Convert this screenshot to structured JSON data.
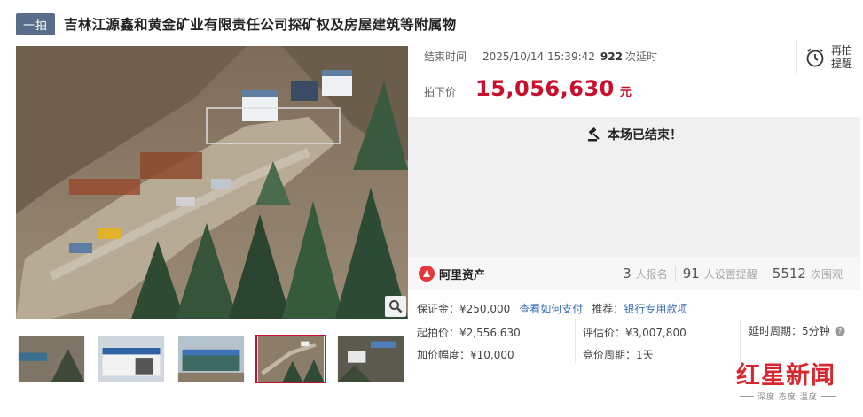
{
  "header": {
    "badge": "一拍",
    "title": "吉林江源鑫和黄金矿业有限责任公司探矿权及房屋建筑等附属物"
  },
  "auction": {
    "end_label": "结束时间",
    "end_time": "2025/10/14 15:39:42",
    "delay_count": "922",
    "delay_suffix": "次延时",
    "price_label": "拍下价",
    "price": "15,056,630",
    "price_unit": "元",
    "remind_label": "再拍提醒",
    "ended_text": "本场已结束！"
  },
  "stats": {
    "platform": "阿里资产",
    "signup_count": "3",
    "signup_label": "人报名",
    "reminder_count": "91",
    "reminder_label": "人设置提醒",
    "views_count": "5512",
    "views_label": "次围观"
  },
  "details": {
    "deposit_label": "保证金：",
    "deposit_value": "¥250,000",
    "pay_link": "查看如何支付",
    "recommend_label": "推荐：",
    "recommend_link": "银行专用款项",
    "start_price": "起拍价：¥2,556,630",
    "appraisal": "评估价：¥3,007,800",
    "delay_period": "延时周期：5分钟",
    "increment": "加价幅度：¥10,000",
    "bid_period": "竞价周期：1天"
  },
  "thumbnails": [
    {
      "name": "thumb-1",
      "active": false
    },
    {
      "name": "thumb-2",
      "active": false
    },
    {
      "name": "thumb-3",
      "active": false
    },
    {
      "name": "thumb-4",
      "active": true
    },
    {
      "name": "thumb-5",
      "active": false
    }
  ],
  "watermark": {
    "title": "红星新闻",
    "subtitle": "深度 态度 温度"
  },
  "colors": {
    "accent": "#c8102e",
    "badge_bg": "#5a6d88",
    "link": "#3a6cb5"
  }
}
